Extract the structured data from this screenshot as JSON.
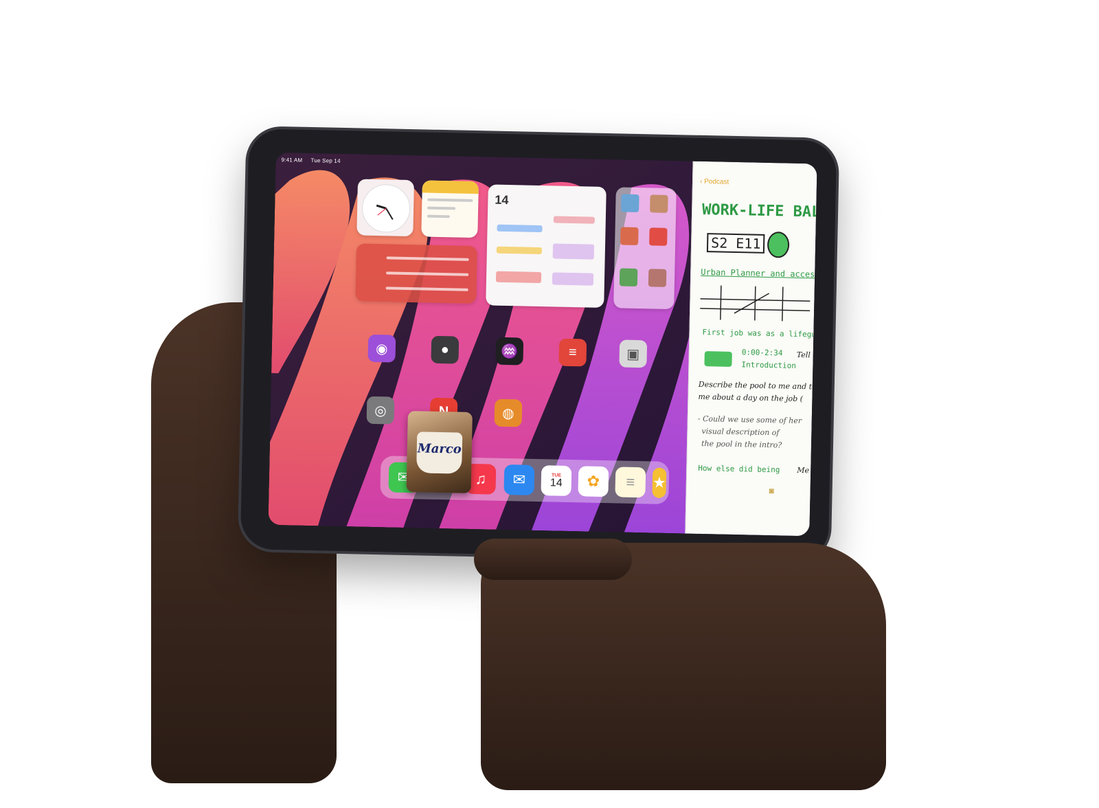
{
  "status_bar": {
    "time": "9:41 AM",
    "date": "Tue Sep 14"
  },
  "dock": {
    "calendar_icon": {
      "day": "TUE",
      "date": "14"
    },
    "apps": [
      "messages-icon",
      "music-icon",
      "mail-icon",
      "calendar-icon",
      "photos-icon",
      "notes-icon",
      "app-library-icon"
    ]
  },
  "pip_video": {
    "label": "Marco"
  },
  "notes_slide_over": {
    "back_label": "Podcast",
    "title": "WORK-LIFE BALAN",
    "episode": "S2 E11",
    "subtitle": "Urban Planner and accessibl",
    "line_1": "First job was as a lifeguard",
    "timestamp": "0:00-2:34",
    "timestamp_label": "Introduction",
    "side_tell": "Tell",
    "prompt_1": "Describe the pool to me and t",
    "prompt_2": "me about a day on the job (",
    "note_1": "- Could we use some of her",
    "note_2": "visual description of",
    "note_3": "the pool in the intro?",
    "question": "How else did being",
    "side_me": "Me"
  },
  "colors": {
    "wallpaper_orange": "#f07a5c",
    "wallpaper_pink": "#e35fa4",
    "wallpaper_purple": "#b64fd6",
    "notes_green": "#2e9a45",
    "notes_accent": "#e2a72e"
  }
}
